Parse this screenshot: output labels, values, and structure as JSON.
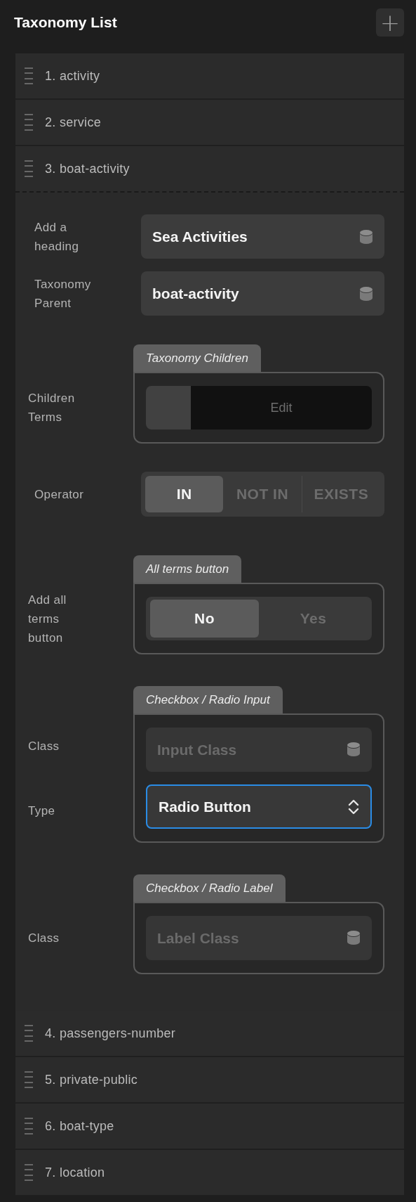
{
  "header": {
    "title": "Taxonomy List",
    "add_button": "+"
  },
  "items": [
    {
      "label": "1. activity",
      "expanded": false
    },
    {
      "label": "2. service",
      "expanded": false
    },
    {
      "label": "3. boat-activity",
      "expanded": true,
      "settings": [
        {
          "kind": "field",
          "label": "Add a heading",
          "value": "Sea Activities"
        },
        {
          "kind": "field",
          "label": "Taxonomy Parent",
          "value": "boat-activity"
        },
        {
          "kind": "group",
          "title": "Taxonomy Children",
          "rows": [
            {
              "kind": "edit",
              "label": "Children Terms",
              "button": "Edit"
            }
          ]
        },
        {
          "kind": "segmented",
          "label": "Operator",
          "options": [
            {
              "label": "IN",
              "selected": true
            },
            {
              "label": "NOT IN",
              "selected": false
            },
            {
              "label": "EXISTS",
              "selected": false
            }
          ]
        },
        {
          "kind": "group",
          "title": "All terms button",
          "rows": [
            {
              "kind": "segmented",
              "label": "Add all terms button",
              "options": [
                {
                  "label": "No",
                  "selected": true
                },
                {
                  "label": "Yes",
                  "selected": false
                }
              ]
            }
          ]
        },
        {
          "kind": "group",
          "title": "Checkbox / Radio Input",
          "rows": [
            {
              "kind": "field",
              "label": "Class",
              "placeholder": "Input Class"
            },
            {
              "kind": "select",
              "label": "Type",
              "value": "Radio Button",
              "focused": true
            }
          ]
        },
        {
          "kind": "group",
          "title": "Checkbox / Radio Label",
          "rows": [
            {
              "kind": "field",
              "label": "Class",
              "placeholder": "Label Class"
            }
          ]
        }
      ]
    },
    {
      "label": "4. passengers-number",
      "expanded": false
    },
    {
      "label": "5. private-public",
      "expanded": false
    },
    {
      "label": "6. boat-type",
      "expanded": false
    },
    {
      "label": "7. location",
      "expanded": false
    }
  ]
}
